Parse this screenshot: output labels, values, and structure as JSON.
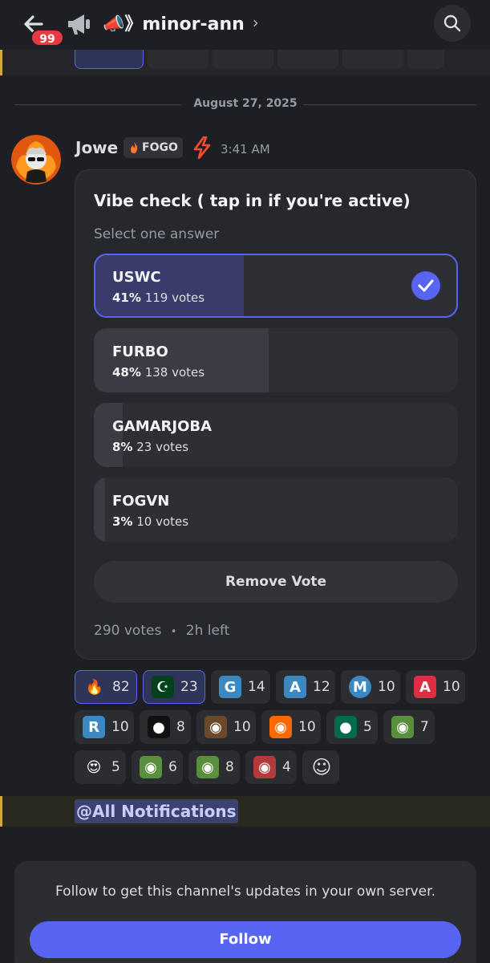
{
  "header": {
    "badge_count": "99",
    "channel_name": "📣》minor-ann",
    "chevron": "›",
    "icons": [
      "back-arrow-icon",
      "megaphone-icon",
      "search-icon"
    ]
  },
  "date_divider": "August 27, 2025",
  "message": {
    "author": "Jowe",
    "tag_label": "FOGO",
    "time": "3:41 AM"
  },
  "poll": {
    "question": "Vibe check ( tap in if you're active)",
    "instruction": "Select one answer",
    "options": [
      {
        "label": "USWC",
        "percent": "41%",
        "votes": "119 votes",
        "share": 41,
        "selected": true
      },
      {
        "label": "FURBO",
        "percent": "48%",
        "votes": "138 votes",
        "share": 48,
        "selected": false
      },
      {
        "label": "GAMARJOBA",
        "percent": "8%",
        "votes": "23 votes",
        "share": 8,
        "selected": false
      },
      {
        "label": "FOGVN",
        "percent": "3%",
        "votes": "10 votes",
        "share": 3,
        "selected": false
      }
    ],
    "remove_label": "Remove Vote",
    "total_votes": "290 votes",
    "separator": "•",
    "time_left": "2h left"
  },
  "reactions": [
    {
      "emoji": "🔥",
      "count": "82",
      "mine": true,
      "icon": "fire-emoji"
    },
    {
      "emoji": "☪",
      "count": "23",
      "mine": true,
      "icon": "pakistan-flag-emoji",
      "color": "#01411c"
    },
    {
      "emoji": "G",
      "count": "14",
      "icon": "letter-g-emoji",
      "color": "#3b88c3"
    },
    {
      "emoji": "A",
      "count": "12",
      "icon": "letter-a-blue-emoji",
      "color": "#3b88c3"
    },
    {
      "emoji": "M",
      "count": "10",
      "icon": "letter-m-circle-emoji",
      "color": "#3b88c3"
    },
    {
      "emoji": "A",
      "count": "10",
      "icon": "letter-a-red-emoji",
      "color": "#dd2e44"
    },
    {
      "emoji": "R",
      "count": "10",
      "icon": "letter-r-emoji",
      "color": "#3b88c3"
    },
    {
      "emoji": "●",
      "count": "8",
      "icon": "fogo-logo-emoji",
      "color": "#111111"
    },
    {
      "emoji": "◉",
      "count": "10",
      "icon": "fire-character-emoji",
      "color": "#6b4a2b"
    },
    {
      "emoji": "◉",
      "count": "10",
      "icon": "flame-avatar-emoji",
      "color": "#ff6a00"
    },
    {
      "emoji": "●",
      "count": "5",
      "icon": "bangladesh-flag-emoji",
      "color": "#006a4e"
    },
    {
      "emoji": "◉",
      "count": "7",
      "icon": "pepe-cowboy-emoji",
      "color": "#5a8f3e"
    },
    {
      "emoji": "😍",
      "count": "5",
      "icon": "star-struck-emoji"
    },
    {
      "emoji": "◉",
      "count": "6",
      "icon": "pepe-sad-emoji",
      "color": "#5a8f3e"
    },
    {
      "emoji": "◉",
      "count": "8",
      "icon": "pepe-usa-emoji",
      "color": "#5a8f3e"
    },
    {
      "emoji": "◉",
      "count": "4",
      "icon": "red-sticker-emoji",
      "color": "#b33a3a"
    },
    {
      "emoji": "☺",
      "count": "",
      "icon": "add-reaction-icon"
    }
  ],
  "mention": "@All Notifications",
  "follow_card": {
    "message": "Follow to get this channel's updates in your own server.",
    "button_label": "Follow"
  },
  "colors": {
    "background": "#1e1f24",
    "accent": "#5865f2",
    "badge": "#e53a40",
    "mention_bar": "#d9a441"
  }
}
